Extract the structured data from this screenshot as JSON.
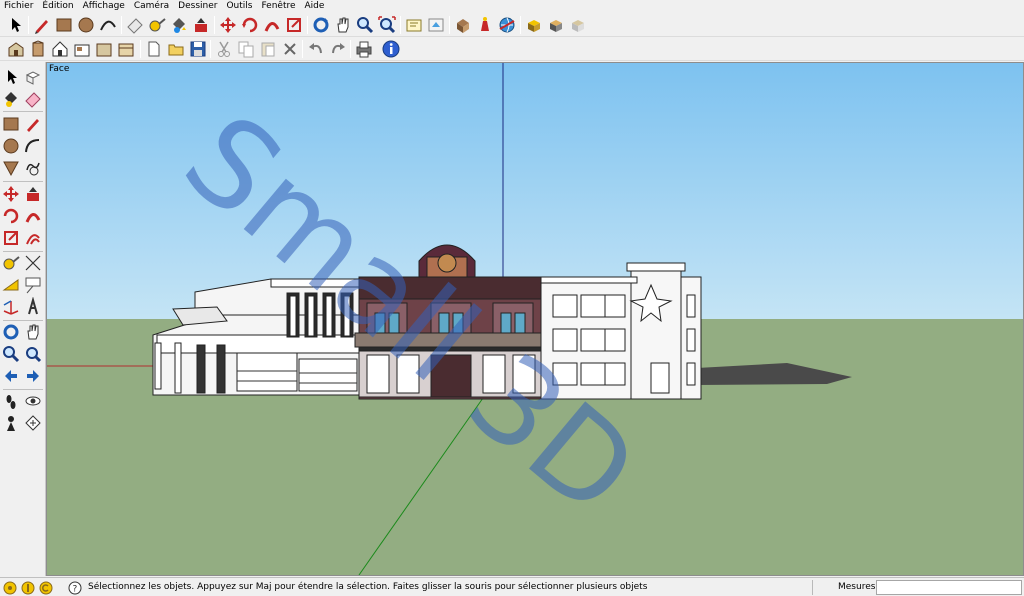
{
  "menu": {
    "items": [
      "Fichier",
      "Édition",
      "Affichage",
      "Caméra",
      "Dessiner",
      "Outils",
      "Fenêtre",
      "Aide"
    ]
  },
  "viewport": {
    "scene_tab": "Face",
    "watermark_text": "Small 3D"
  },
  "status": {
    "hint": "Sélectionnez les objets. Appuyez sur Maj pour étendre la sélection. Faites glisser la souris pour sélectionner plusieurs objets",
    "measures_label": "Mesures",
    "measures_value": ""
  },
  "colors": {
    "sky_top": "#7dc2f0",
    "sky_bottom": "#c4e4f5",
    "ground": "#93ad82",
    "watermark": "#3560b8"
  },
  "toolbar_icons_row1": [
    "select-icon",
    "pencil-icon",
    "rectangle-icon",
    "circle-icon",
    "arc-icon",
    "eraser-icon",
    "tape-measure-icon",
    "paint-bucket-icon",
    "pushpull-icon",
    "move-icon",
    "rotate-icon",
    "follow-me-icon",
    "scale-icon",
    "offset-icon",
    "orbit-icon",
    "pan-icon",
    "zoom-icon",
    "zoom-extents-icon",
    "previous-view-icon",
    "warehouse-icon",
    "get-models-icon",
    "share-model-icon",
    "place-model-icon",
    "components-icon",
    "styles-icon"
  ],
  "toolbar_icons_row2": [
    "iso-view-icon",
    "top-view-icon",
    "front-view-icon",
    "right-view-icon",
    "back-view-icon",
    "left-view-icon",
    "new-icon",
    "open-icon",
    "save-icon",
    "cut-icon",
    "copy-icon",
    "paste-icon",
    "delete-icon",
    "undo-icon",
    "redo-icon",
    "print-icon",
    "model-info-icon"
  ]
}
